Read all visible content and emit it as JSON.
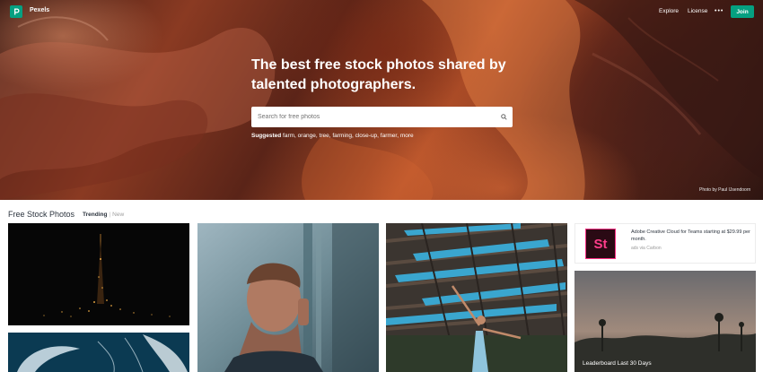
{
  "header": {
    "brand": "Pexels",
    "nav": [
      "Explore",
      "License"
    ],
    "more_label": "•••",
    "join_label": "Join"
  },
  "hero": {
    "headline": "The best free stock photos shared by talented photographers.",
    "search_placeholder": "Search for free photos",
    "suggested_label": "Suggested",
    "suggestions": "farm, orange, tree, farming, close-up, farmer, more",
    "photo_credit": "Photo by Paul IJsendoorn"
  },
  "gallery": {
    "title": "Free Stock Photos",
    "tab_trending": "Trending",
    "tab_separator": "|",
    "tab_new": "New"
  },
  "ad": {
    "logo_text": "St",
    "text": "Adobe Creative Cloud for Teams starting at $29.99 per month.",
    "via": "ads via Carbon"
  },
  "leaderboard": {
    "label": "Leaderboard Last 30 Days"
  },
  "colors": {
    "brand_green": "#05a081",
    "text_dark": "#2c343e"
  }
}
